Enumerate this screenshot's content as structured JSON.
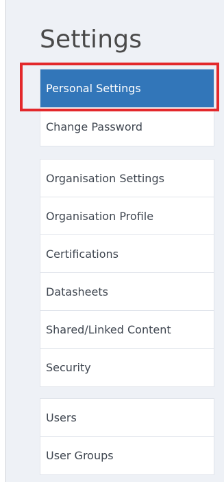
{
  "settings": {
    "title": "Settings",
    "personal": [
      {
        "label": "Personal Settings",
        "active": true
      },
      {
        "label": "Change Password"
      }
    ],
    "organisation": [
      {
        "label": "Organisation Settings"
      },
      {
        "label": "Organisation Profile"
      },
      {
        "label": "Certifications"
      },
      {
        "label": "Datasheets"
      },
      {
        "label": "Shared/Linked Content"
      },
      {
        "label": "Security"
      }
    ],
    "users": [
      {
        "label": "Users"
      },
      {
        "label": "User Groups"
      }
    ]
  },
  "colors": {
    "active_bg": "#3276b9",
    "highlight": "#e3282b",
    "panel_bg": "#eef1f6"
  }
}
